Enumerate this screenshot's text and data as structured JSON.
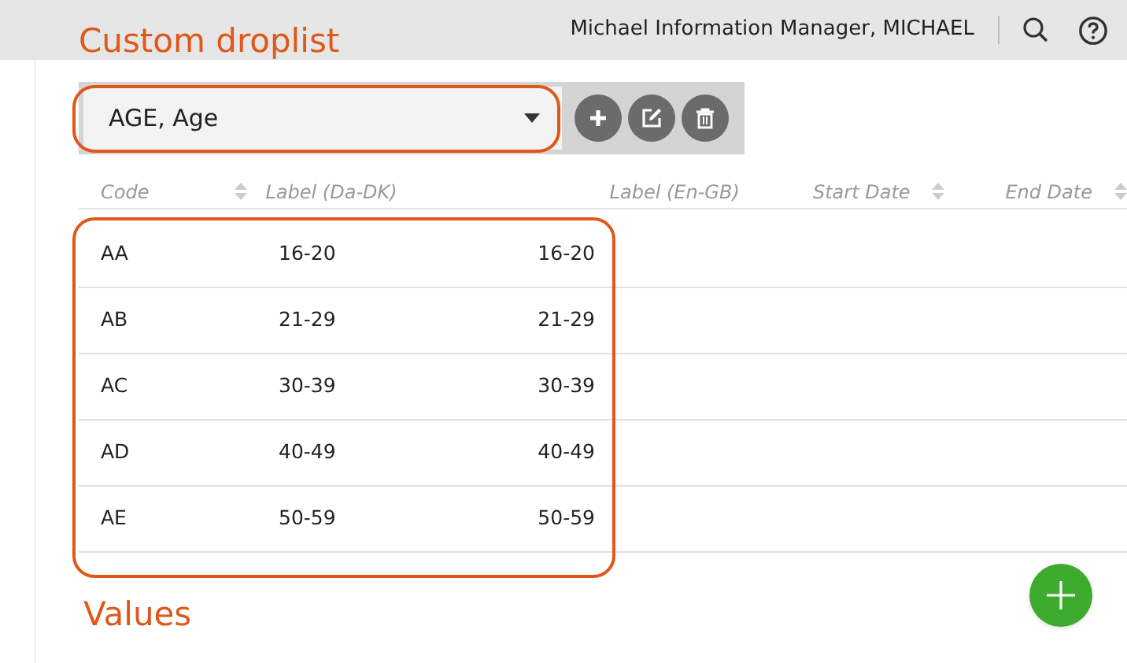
{
  "header": {
    "user": "Michael Information Manager, MICHAEL"
  },
  "droplist": {
    "value": "AGE, Age"
  },
  "table": {
    "columns": [
      {
        "label": "Code",
        "sortable": true
      },
      {
        "label": "Label (Da-DK)",
        "sortable": false
      },
      {
        "label": "Label (En-GB)",
        "sortable": false
      },
      {
        "label": "Start Date",
        "sortable": true
      },
      {
        "label": "End Date",
        "sortable": true
      }
    ],
    "rows": [
      [
        "AA",
        "16-20",
        "16-20"
      ],
      [
        "AB",
        "21-29",
        "21-29"
      ],
      [
        "AC",
        "30-39",
        "30-39"
      ],
      [
        "AD",
        "40-49",
        "40-49"
      ],
      [
        "AE",
        "50-59",
        "50-59"
      ]
    ]
  },
  "annotations": [
    {
      "label": "Custom droplist"
    },
    {
      "label": "Values"
    }
  ]
}
